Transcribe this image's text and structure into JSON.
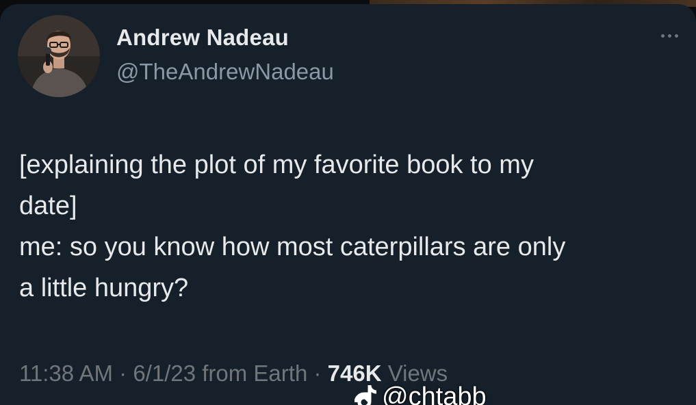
{
  "tweet": {
    "author": {
      "display_name": "Andrew Nadeau",
      "handle": "@TheAndrewNadeau",
      "avatar": "comedian-with-microphone-photo"
    },
    "more_icon": "ellipsis-horizontal-icon",
    "text_lines": [
      "[explaining the plot of my favorite book to my",
      "date]",
      "me: so you know how most caterpillars are only",
      "a little hungry?"
    ],
    "meta": {
      "time": "11:38 AM",
      "date": "6/1/23",
      "source": "from Earth",
      "separator": "·",
      "views_count": "746K",
      "views_label": "Views"
    }
  },
  "watermark": {
    "icon": "tiktok-logo-icon",
    "handle": "@chtabb"
  },
  "colors": {
    "card_background": "#15202b",
    "primary_text": "#e7e9ea",
    "secondary_text": "#8b98a5",
    "meta_text": "#71767b"
  }
}
